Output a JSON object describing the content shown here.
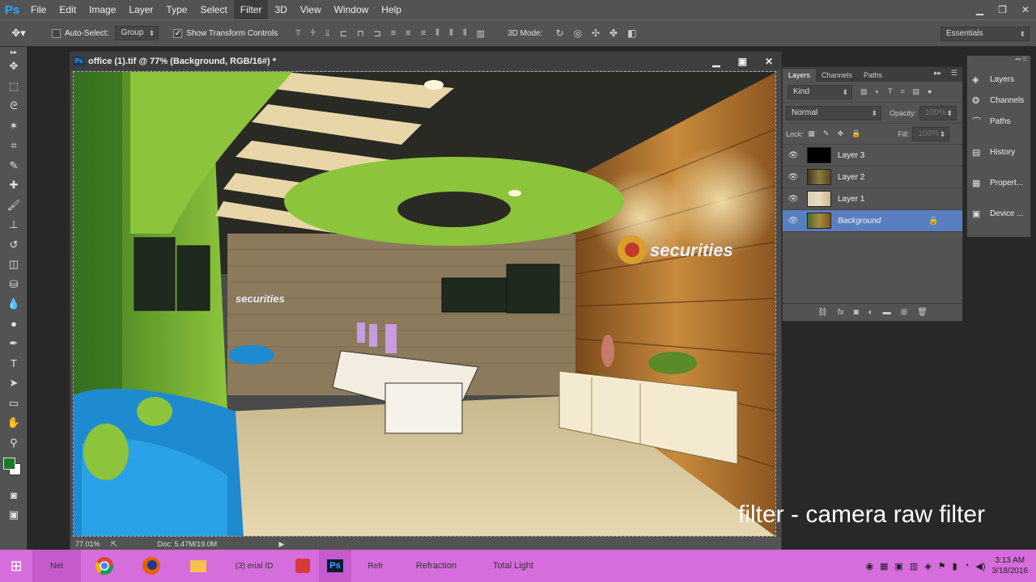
{
  "menubar": {
    "app_logo": "Ps",
    "items": [
      "File",
      "Edit",
      "Image",
      "Layer",
      "Type",
      "Select",
      "Filter",
      "3D",
      "View",
      "Window",
      "Help"
    ],
    "active_item": "Filter"
  },
  "options": {
    "auto_select_label": "Auto-Select:",
    "auto_select_checked": false,
    "auto_select_target": "Group",
    "transform_label": "Show Transform Controls",
    "transform_checked": true,
    "mode_3d_label": "3D Mode:",
    "workspace": "Essentials"
  },
  "document": {
    "title": "office (1).tif @ 77% (Background, RGB/16#) *",
    "zoom": "77.01%",
    "doc_size": "Doc: 5.47M/19.0M"
  },
  "layers_panel": {
    "tabs": [
      "Layers",
      "Channels",
      "Paths"
    ],
    "active_tab": "Layers",
    "filter_kind": "Kind",
    "blend_mode": "Normal",
    "opacity_label": "Opacity:",
    "opacity_value": "100%",
    "lock_label": "Lock:",
    "fill_label": "Fill:",
    "fill_value": "100%",
    "layers": [
      {
        "name": "Layer 3",
        "selected": false
      },
      {
        "name": "Layer 2",
        "selected": false
      },
      {
        "name": "Layer 1",
        "selected": false
      },
      {
        "name": "Background",
        "selected": true
      }
    ]
  },
  "dock": {
    "items": [
      "Layers",
      "Channels",
      "Paths",
      "History",
      "Propert...",
      "Device ..."
    ]
  },
  "canvas_signs": {
    "left_sign": "securities",
    "right_sign": "securities"
  },
  "caption": "filter - camera raw filter",
  "taskbar": {
    "items_partial": [
      "Net",
      "(3)",
      "erial ID",
      "Refr",
      "Refraction",
      "Total Light"
    ],
    "clock_time": "3:13 AM",
    "clock_date": "3/18/2016"
  },
  "colors": {
    "accent_green": "#8cc43c",
    "selection_blue": "#5a7fc0",
    "taskbar": "#d66ddc",
    "foreground_color": "#1a7a2c"
  }
}
